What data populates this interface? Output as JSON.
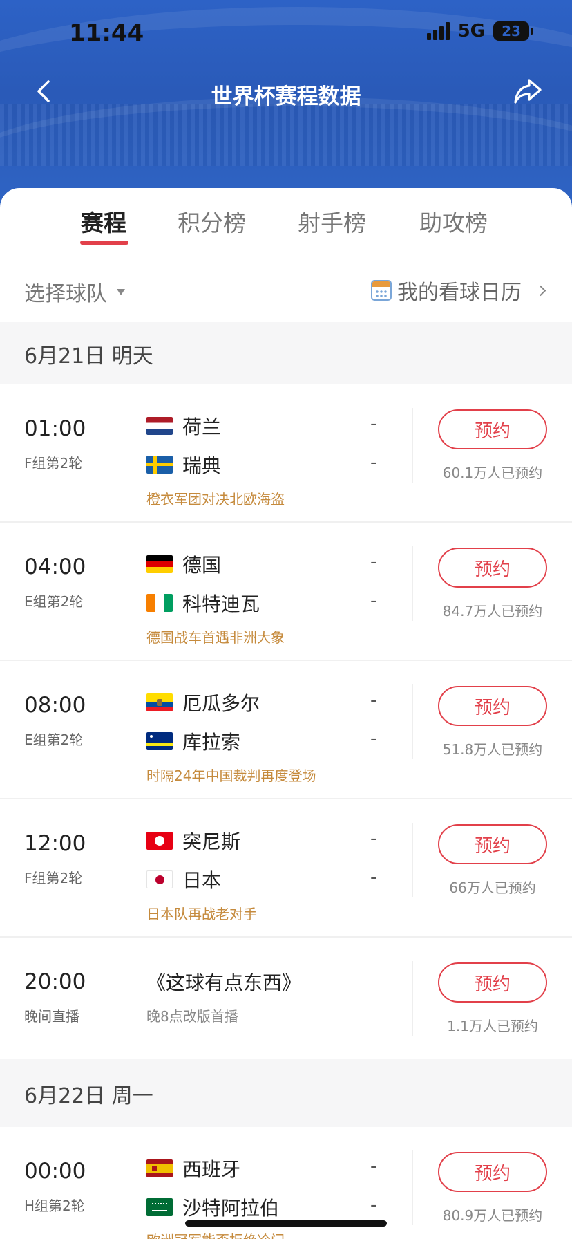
{
  "status_bar": {
    "time": "11:44",
    "network": "5G",
    "battery": "23"
  },
  "nav": {
    "title": "世界杯赛程数据",
    "back_icon": "chevron-left-icon",
    "share_icon": "share-arrow-icon"
  },
  "tabs": [
    {
      "label": "赛程",
      "active": true
    },
    {
      "label": "积分榜",
      "active": false
    },
    {
      "label": "射手榜",
      "active": false
    },
    {
      "label": "助攻榜",
      "active": false
    }
  ],
  "filter": {
    "team_select": "选择球队",
    "calendar_link": "我的看球日历"
  },
  "dates": [
    {
      "label": "6月21日 明天"
    },
    {
      "label": "6月22日 周一"
    }
  ],
  "matches": [
    {
      "time": "01:00",
      "group": "F组第2轮",
      "home": "荷兰",
      "away": "瑞典",
      "home_score": "-",
      "away_score": "-",
      "desc": "橙衣军团对决北欧海盗",
      "button": "预约",
      "count": "60.1万人已预约"
    },
    {
      "time": "04:00",
      "group": "E组第2轮",
      "home": "德国",
      "away": "科特迪瓦",
      "home_score": "-",
      "away_score": "-",
      "desc": "德国战车首遇非洲大象",
      "button": "预约",
      "count": "84.7万人已预约"
    },
    {
      "time": "08:00",
      "group": "E组第2轮",
      "home": "厄瓜多尔",
      "away": "库拉索",
      "home_score": "-",
      "away_score": "-",
      "desc": "时隔24年中国裁判再度登场",
      "button": "预约",
      "count": "51.8万人已预约"
    },
    {
      "time": "12:00",
      "group": "F组第2轮",
      "home": "突尼斯",
      "away": "日本",
      "home_score": "-",
      "away_score": "-",
      "desc": "日本队再战老对手",
      "button": "预约",
      "count": "66万人已预约"
    },
    {
      "time": "00:00",
      "group": "H组第2轮",
      "home": "西班牙",
      "away": "沙特阿拉伯",
      "home_score": "-",
      "away_score": "-",
      "desc": "欧洲冠军能否拒绝冷门",
      "button": "预约",
      "count": "80.9万人已预约"
    }
  ],
  "show": {
    "time": "20:00",
    "group": "晚间直播",
    "title": "《这球有点东西》",
    "subtitle": "晚8点改版首播",
    "button": "预约",
    "count": "1.1万人已预约"
  },
  "colors": {
    "header_blue": "#2d62c6",
    "accent_red": "#e2404a",
    "desc_orange": "#c58a3c"
  }
}
